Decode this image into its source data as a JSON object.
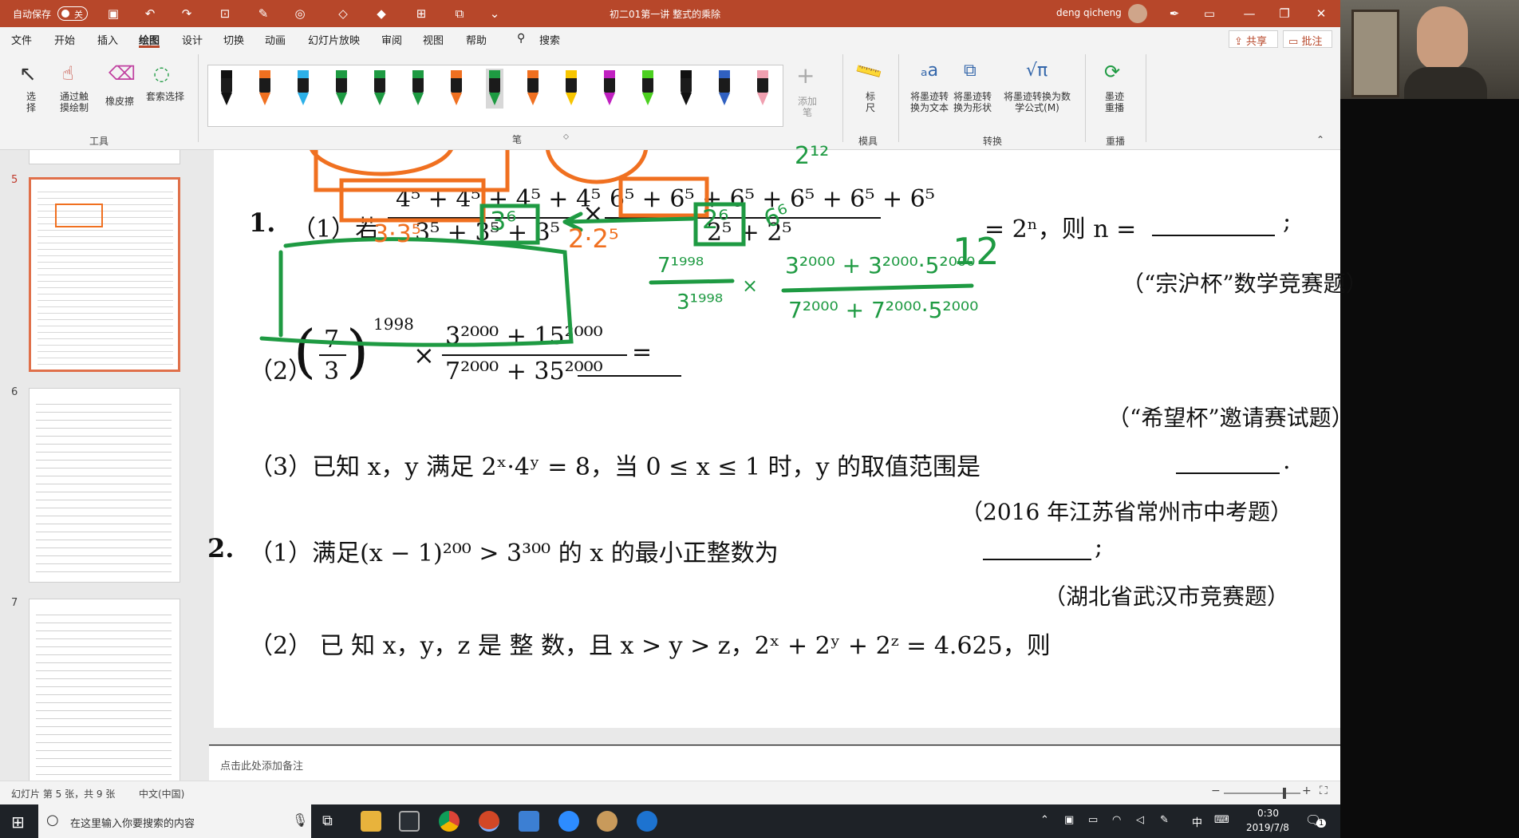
{
  "titlebar": {
    "autosave_label": "自动保存",
    "autosave_state": "关",
    "doc_title": "初二01第一讲 整式的乘除",
    "user_name": "deng qicheng"
  },
  "menubar": {
    "items": [
      "文件",
      "开始",
      "插入",
      "绘图",
      "设计",
      "切换",
      "动画",
      "幻灯片放映",
      "审阅",
      "视图",
      "帮助"
    ],
    "active": "绘图",
    "search_label": "搜索",
    "share_label": "共享",
    "comment_label": "批注"
  },
  "ribbon": {
    "tools": {
      "select": "选\n择",
      "touch_draw": "通过触\n摸绘制",
      "eraser": "橡皮擦",
      "lasso": "套索选择",
      "group_name": "工具"
    },
    "pens_group_name": "笔",
    "add_pen_label": "添加\n笔",
    "pen_colors": [
      "#111111",
      "#f07020",
      "#2cb0e8",
      "#1e9a42",
      "#1e9a42",
      "#1e9a42",
      "#f07020",
      "#1e9a42",
      "#f07020",
      "#f7c500",
      "#c020c0",
      "#4cd020",
      "#111111",
      "#3060c0",
      "#f0a0b0"
    ],
    "stencils": {
      "ruler": "标\n尺",
      "group_name": "模具"
    },
    "convert": {
      "ink_to_text": "将墨迹转\n换为文本",
      "ink_to_shape": "将墨迹转\n换为形状",
      "ink_to_math": "将墨迹转换为数\n学公式(M)",
      "group_name": "转换"
    },
    "replay": {
      "ink_replay": "墨迹\n重播",
      "group_name": "重播"
    }
  },
  "slides_pane": {
    "numbers": [
      "5",
      "6",
      "7"
    ],
    "selected": "5"
  },
  "slide": {
    "p1_num": "1.",
    "p1_part1": "（1）若",
    "p1_eq_tail": "= 2ⁿ，则 n =",
    "p1_source": "（“宗沪杯”数学竞赛题）",
    "p1_part2": "（2）",
    "p1_part2_source": "（“希望杯”邀请赛试题）",
    "p1_part3": "（3）已知 x，y 满足 2ˣ·4ʸ = 8，当 0 ≤ x ≤ 1 时，y 的取值范围是",
    "p1_part3_source": "（2016 年江苏省常州市中考题）",
    "p2_num": "2.",
    "p2_part1": "（1）满足(x − 1)²⁰⁰ > 3³⁰⁰ 的 x 的最小正整数为",
    "p2_part1_source": "（湖北省武汉市竞赛题）",
    "p2_part2": "（2） 已 知  x，y，z  是 整 数，且  x > y > z，2ˣ + 2ʸ + 2ᶻ = 4.625，则"
  },
  "ink": {
    "answer_n": "12",
    "note_3x3": "3·3⁵",
    "note_36": "3⁶",
    "note_22": "2·2⁵",
    "note_26": "2⁶",
    "note_6": "6⁶",
    "note_212": "2¹²",
    "note_7_1998": "7¹⁹⁹⁸",
    "note_3_1998": "3¹⁹⁹⁸",
    "note_x": "×",
    "note_num": "3²⁰⁰⁰ + 3²⁰⁰⁰·5²⁰⁰⁰",
    "note_den": "7²⁰⁰⁰ + 7²⁰⁰⁰·5²⁰⁰⁰"
  },
  "notes_placeholder": "点击此处添加备注",
  "statusbar": {
    "slide_info": "幻灯片 第 5 张，共 9 张",
    "language": "中文(中国)"
  },
  "taskbar": {
    "search_placeholder": "在这里输入你要搜索的内容",
    "ime": "中",
    "time": "0:30",
    "date": "2019/7/8",
    "notif_count": "1"
  }
}
